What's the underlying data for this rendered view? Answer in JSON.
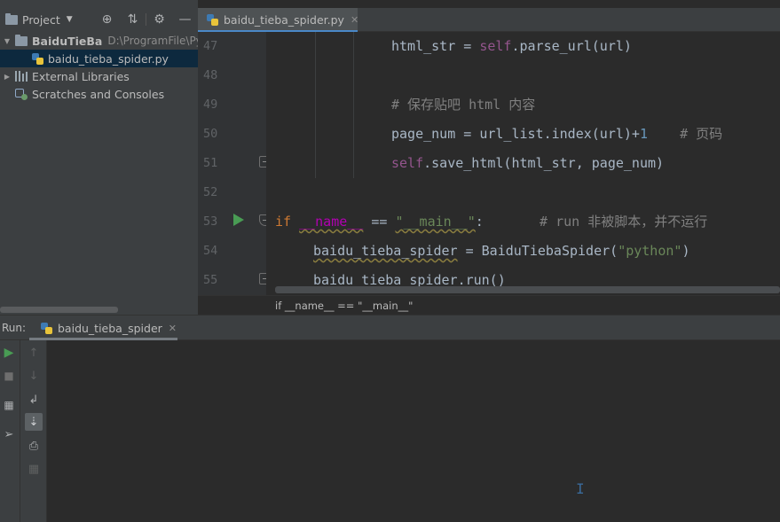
{
  "project_panel": {
    "title": "Project",
    "tree": [
      {
        "name": "BaiduTieBa",
        "path": "D:\\ProgramFile\\PycharmProjects"
      },
      {
        "name": "baidu_tieba_spider.py"
      },
      {
        "name": "External Libraries"
      },
      {
        "name": "Scratches and Consoles"
      }
    ]
  },
  "editor": {
    "tab": {
      "label": "baidu_tieba_spider.py"
    },
    "lines": [
      {
        "n": "47"
      },
      {
        "n": "48"
      },
      {
        "n": "49"
      },
      {
        "n": "50"
      },
      {
        "n": "51"
      },
      {
        "n": "52"
      },
      {
        "n": "53"
      },
      {
        "n": "54"
      },
      {
        "n": "55"
      }
    ],
    "code": {
      "l47_a": "html_str = ",
      "l47_self": "self",
      "l47_b": ".parse_url(url)",
      "l49": "# 保存贴吧 html 内容",
      "l50_a": "page_num = url_list.index(url)+",
      "l50_num": "1",
      "l50_cmt": "    # 页码",
      "l51_self": "self",
      "l51_b": ".save_html(html_str, page_num)",
      "l53_if": "if ",
      "l53_name": "__name__",
      "l53_eq": " == ",
      "l53_str": "\"__main__\"",
      "l53_colon": ":",
      "l53_cmt": "       # run 非被脚本，并不运行",
      "l54_a": "baidu_tieba_spider",
      "l54_b": " = BaiduTiebaSpider(",
      "l54_str": "\"python\"",
      "l54_c": ")",
      "l55_a": "baidu_tieba_spider",
      "l55_b": ".run()"
    },
    "breadcrumb": "if __name__ == \"__main__\""
  },
  "run_panel": {
    "label": "Run:",
    "tab": {
      "label": "baidu_tieba_spider"
    }
  },
  "colors": {
    "keyword": "#cc7832",
    "self": "#94558d",
    "comment": "#808080",
    "number": "#6897bb",
    "string": "#6a8759",
    "run_green": "#499c54"
  },
  "icons": {
    "project_header": [
      "locate-icon",
      "collapse-all-icon",
      "gear-icon",
      "minimize-icon"
    ],
    "run_toolbar": [
      "rerun-icon",
      "stop-icon",
      "layout-icon",
      "pin-icon",
      "scroll-up-icon",
      "scroll-down-icon",
      "soft-wrap-icon",
      "scroll-to-end-icon",
      "print-icon",
      "trash-icon"
    ]
  }
}
